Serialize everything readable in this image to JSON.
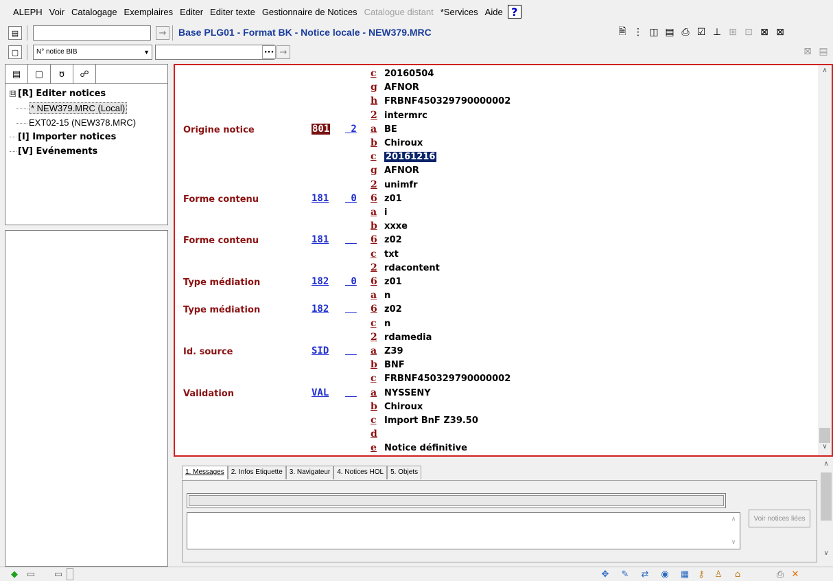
{
  "menu": {
    "items": [
      "ALEPH",
      "Voir",
      "Catalogage",
      "Exemplaires",
      "Editer",
      "Editer texte",
      "Gestionnaire de Notices",
      "Catalogue distant",
      "*Services",
      "Aide"
    ],
    "disabled_item": "Catalogue distant",
    "help_icon": "question-mark-icon"
  },
  "toolbar": {
    "base_title": "Base PLG01 - Format BK - Notice locale - NEW379.MRC",
    "search_field_value": "",
    "index_select_value": "N° notice BIB",
    "index_input_value": "",
    "browse_label": "···"
  },
  "left_tabs": [
    "edit-record-icon",
    "page-icon",
    "hand-icon",
    "binoculars-icon"
  ],
  "tree": {
    "root_box": "⊟",
    "root": "[R] Editer notices",
    "children": [
      "* NEW379.MRC (Local)",
      "EXT02-15 (NEW378.MRC)"
    ],
    "import": "[I] Importer notices",
    "events": "[V] Evénements"
  },
  "record": [
    {
      "label": "",
      "tag": "",
      "ind": "",
      "code": "c",
      "value": "20160504"
    },
    {
      "label": "",
      "tag": "",
      "ind": "",
      "code": "g",
      "value": "AFNOR"
    },
    {
      "label": "",
      "tag": "",
      "ind": "",
      "code": "h",
      "value": "FRBNF450329790000002"
    },
    {
      "label": "",
      "tag": "",
      "ind": "",
      "code": "2",
      "value": "intermrc"
    },
    {
      "label": "Origine notice",
      "tag": "801",
      "ind": " 2",
      "code": "a",
      "value": "BE",
      "tag_selected": true
    },
    {
      "label": "",
      "tag": "",
      "ind": "",
      "code": "b",
      "value": "Chiroux"
    },
    {
      "label": "",
      "tag": "",
      "ind": "",
      "code": "c",
      "value": "20161216",
      "highlight": true
    },
    {
      "label": "",
      "tag": "",
      "ind": "",
      "code": "g",
      "value": "AFNOR"
    },
    {
      "label": "",
      "tag": "",
      "ind": "",
      "code": "2",
      "value": "unimfr"
    },
    {
      "label": "Forme contenu",
      "tag": "181",
      "ind": " 0",
      "code": "6",
      "value": "z01"
    },
    {
      "label": "",
      "tag": "",
      "ind": "",
      "code": "a",
      "value": "i"
    },
    {
      "label": "",
      "tag": "",
      "ind": "",
      "code": "b",
      "value": "xxxe"
    },
    {
      "label": "Forme contenu",
      "tag": "181",
      "ind": "  ",
      "code": "6",
      "value": "z02"
    },
    {
      "label": "",
      "tag": "",
      "ind": "",
      "code": "c",
      "value": "txt"
    },
    {
      "label": "",
      "tag": "",
      "ind": "",
      "code": "2",
      "value": "rdacontent"
    },
    {
      "label": "Type médiation",
      "tag": "182",
      "ind": " 0",
      "code": "6",
      "value": "z01"
    },
    {
      "label": "",
      "tag": "",
      "ind": "",
      "code": "a",
      "value": "n"
    },
    {
      "label": "Type médiation",
      "tag": "182",
      "ind": "  ",
      "code": "6",
      "value": "z02"
    },
    {
      "label": "",
      "tag": "",
      "ind": "",
      "code": "c",
      "value": "n"
    },
    {
      "label": "",
      "tag": "",
      "ind": "",
      "code": "2",
      "value": "rdamedia"
    },
    {
      "label": "Id. source",
      "tag": "SID",
      "ind": "  ",
      "code": "a",
      "value": "Z39"
    },
    {
      "label": "",
      "tag": "",
      "ind": "",
      "code": "b",
      "value": "BNF"
    },
    {
      "label": "",
      "tag": "",
      "ind": "",
      "code": "c",
      "value": "FRBNF450329790000002"
    },
    {
      "label": "Validation",
      "tag": "VAL",
      "ind": "  ",
      "code": "a",
      "value": "NYSSENY"
    },
    {
      "label": "",
      "tag": "",
      "ind": "",
      "code": "b",
      "value": "Chiroux"
    },
    {
      "label": "",
      "tag": "",
      "ind": "",
      "code": "c",
      "value": "Import BnF Z39.50"
    },
    {
      "label": "",
      "tag": "",
      "ind": "",
      "code": "d",
      "value": ""
    },
    {
      "label": "",
      "tag": "",
      "ind": "",
      "code": "e",
      "value": "Notice définitive"
    }
  ],
  "bottom": {
    "tabs": [
      "1. Messages",
      "2. Infos Etiquette",
      "3. Navigateur",
      "4. Notices HOL",
      "5. Objets"
    ],
    "active_tab": 0,
    "voir_button": "Voir notices liées"
  },
  "colors": {
    "label": "#8b1010",
    "tag": "#1f2fd0",
    "selection": "#0a246a",
    "border_active": "#d02020"
  }
}
